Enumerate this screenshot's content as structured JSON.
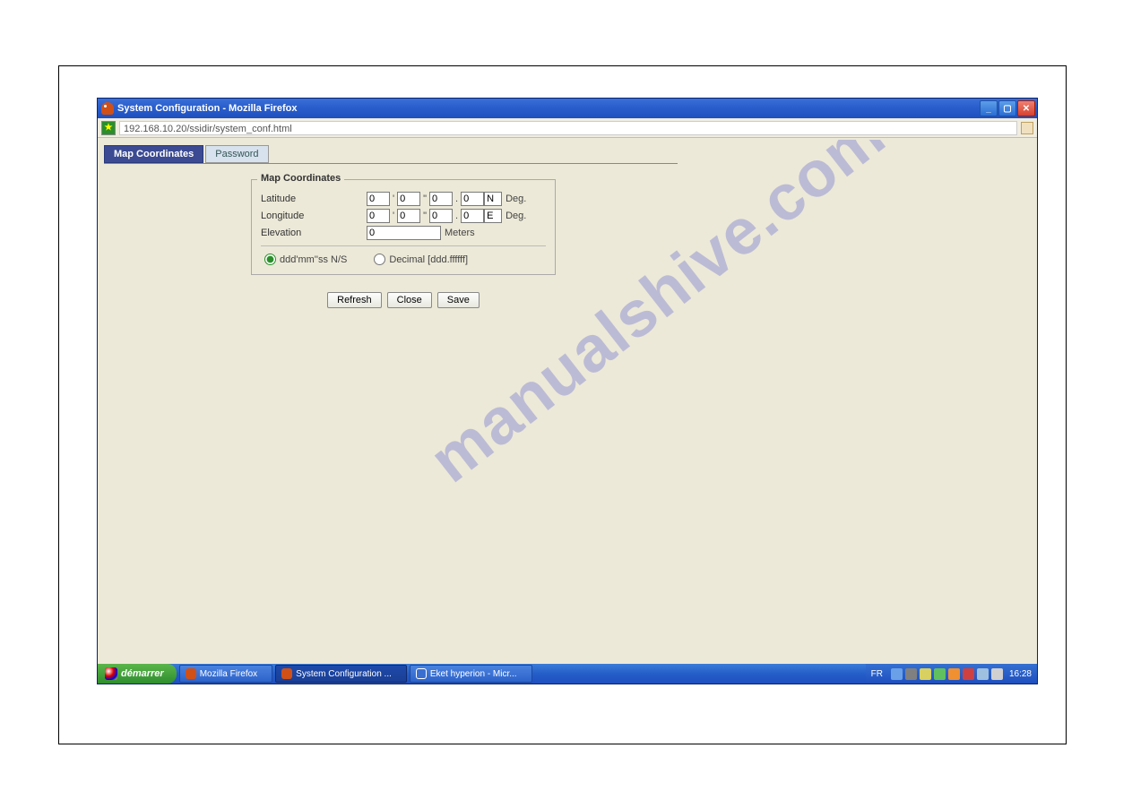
{
  "window": {
    "title": "System Configuration - Mozilla Firefox"
  },
  "url_bar": {
    "address": "192.168.10.20/ssidir/system_conf.html"
  },
  "tabs": {
    "active": "Map Coordinates",
    "inactive": "Password"
  },
  "fieldset": {
    "legend": "Map Coordinates",
    "rows": {
      "latitude": {
        "label": "Latitude",
        "deg": "0",
        "min": "0",
        "sec": "0",
        "dec": "0",
        "hemi": "N",
        "unit": "Deg."
      },
      "longitude": {
        "label": "Longitude",
        "deg": "0",
        "min": "0",
        "sec": "0",
        "dec": "0",
        "hemi": "E",
        "unit": "Deg."
      },
      "elevation": {
        "label": "Elevation",
        "value": "0",
        "unit": "Meters"
      }
    },
    "marks": {
      "tick1": "'",
      "tick2": "\"",
      "dot": "."
    },
    "format_options": {
      "dms": "ddd'mm''ss N/S",
      "decimal": "Decimal [ddd.ffffff]"
    }
  },
  "buttons": {
    "refresh": "Refresh",
    "close": "Close",
    "save": "Save"
  },
  "taskbar": {
    "start": "démarrer",
    "items": [
      "Mozilla Firefox",
      "System Configuration ...",
      "Eket hyperion - Micr..."
    ],
    "lang": "FR",
    "clock": "16:28"
  },
  "watermark": "manualshive.com"
}
